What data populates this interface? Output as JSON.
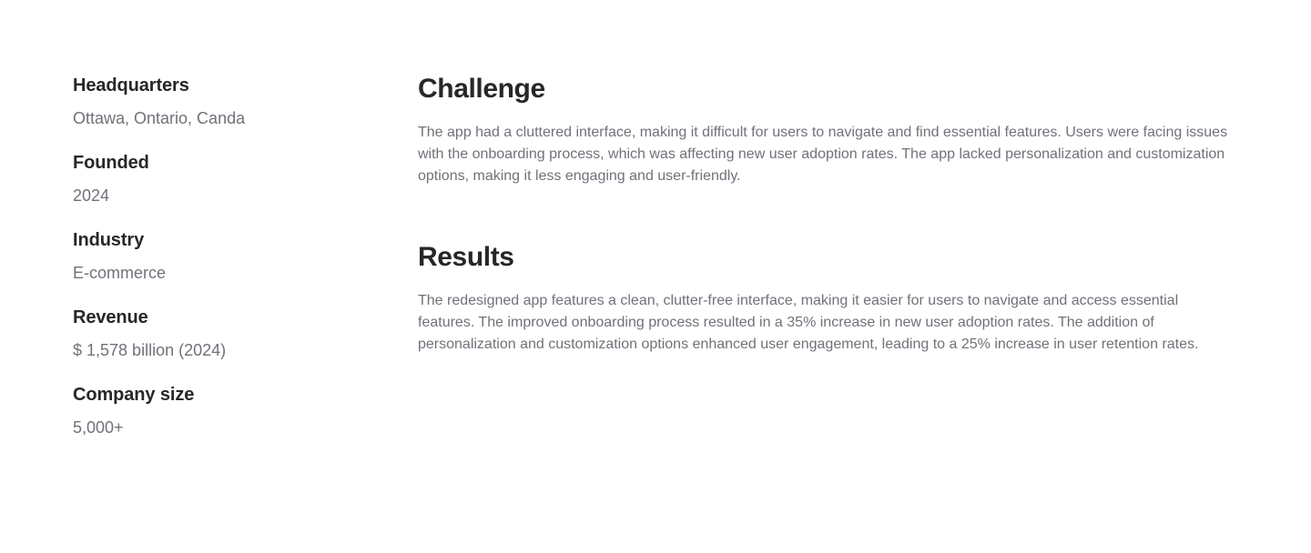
{
  "facts": [
    {
      "label": "Headquarters",
      "value": "Ottawa, Ontario, Canda"
    },
    {
      "label": "Founded",
      "value": "2024"
    },
    {
      "label": "Industry",
      "value": "E-commerce"
    },
    {
      "label": "Revenue",
      "value": "$ 1,578 billion (2024)"
    },
    {
      "label": "Company size",
      "value": "5,000+"
    }
  ],
  "sections": [
    {
      "title": "Challenge",
      "body": "The app had a cluttered interface, making it difficult for users to navigate and find essential features. Users were facing issues with the onboarding process, which was affecting new user adoption rates. The app lacked personalization and customization options, making it less engaging and user-friendly."
    },
    {
      "title": "Results",
      "body": "The redesigned app features a clean, clutter-free interface, making it easier for users to navigate and access essential features. The improved onboarding process resulted in a 35% increase in new user adoption rates. The addition of personalization and customization options enhanced user engagement, leading to a 25% increase in user retention rates."
    }
  ]
}
